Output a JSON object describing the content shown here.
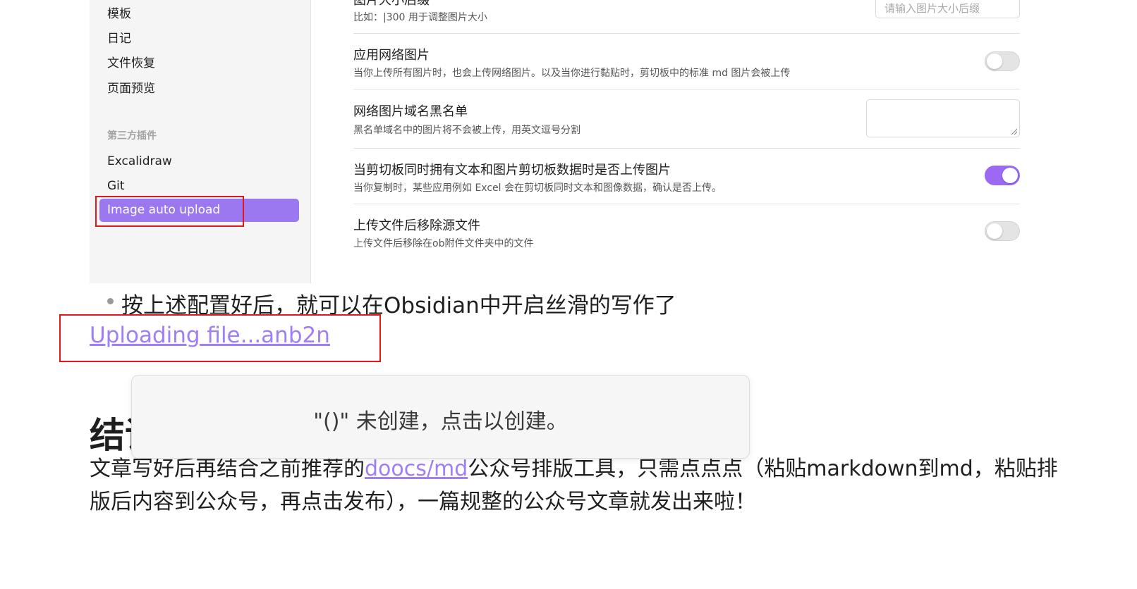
{
  "sidebar": {
    "core_items": [
      "模板",
      "日记",
      "文件恢复",
      "页面预览"
    ],
    "section_label": "第三方插件",
    "plugin_items": [
      "Excalidraw",
      "Git"
    ],
    "active_item": "Image auto upload"
  },
  "settings": {
    "image_size_suffix": {
      "title": "图片大小后缀",
      "desc": "比如：|300 用于调整图片大小",
      "placeholder": "请输入图片大小后缀"
    },
    "apply_network_images": {
      "title": "应用网络图片",
      "desc": "当你上传所有图片时，也会上传网络图片。以及当你进行黏贴时，剪切板中的标准 md 图片会被上传",
      "enabled": false
    },
    "domain_blacklist": {
      "title": "网络图片域名黑名单",
      "desc": "黑名单域名中的图片将不会被上传，用英文逗号分割"
    },
    "upload_when_text_and_image": {
      "title": "当剪切板同时拥有文本和图片剪切板数据时是否上传图片",
      "desc": "当你复制时，某些应用例如 Excel 会在剪切板同时文本和图像数据，确认是否上传。",
      "enabled": true
    },
    "delete_source_after_upload": {
      "title": "上传文件后移除源文件",
      "desc": "上传文件后移除在ob附件文件夹中的文件",
      "enabled": false
    }
  },
  "document": {
    "bullet": "按上述配置好后，就可以在Obsidian中开启丝滑的写作了",
    "upload_link": "Uploading file...anb2n",
    "heading": "结语",
    "paragraph_before": "文章写好后再结合之前推荐的",
    "paragraph_link": "doocs/md",
    "paragraph_after": "公众号排版工具，只需点点点（粘贴markdown到md，粘贴排版后内容到公众号，再点击发布），一篇规整的公众号文章就发出来啦！"
  },
  "toast": {
    "message": "\"()\" 未创建，点击以创建。"
  },
  "colors": {
    "accent": "#9b78f0",
    "link": "#a07ef5",
    "highlight_box": "#e4161d"
  }
}
